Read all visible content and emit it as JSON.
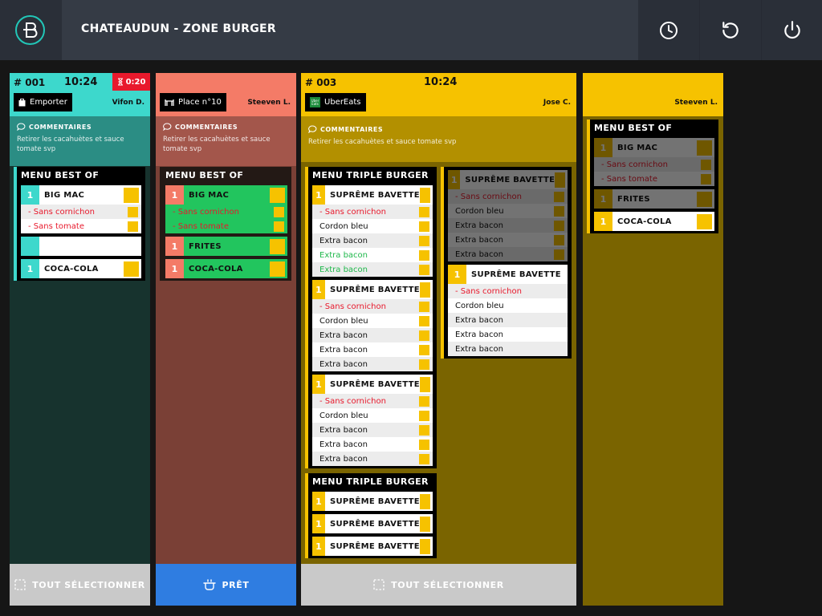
{
  "header": {
    "title": "CHATEAUDUN - ZONE BURGER"
  },
  "orders": [
    {
      "number": "# 001",
      "time": "10:24",
      "timer": "0:20",
      "tag": "Emporter",
      "staff": "Vifon D.",
      "comment_label": "COMMENTAIRES",
      "comment": "Retirer les cacahuètes et sauce tomate svp",
      "menu_title": "MENU BEST OF",
      "items": [
        {
          "qty": "1",
          "name": "BIG MAC",
          "mods": [
            "- Sans cornichon",
            "- Sans tomate"
          ]
        },
        {
          "qty": "",
          "name": "",
          "mods": []
        },
        {
          "qty": "1",
          "name": "COCA-COLA",
          "mods": []
        }
      ],
      "footer": "TOUT SÉLECTIONNER"
    },
    {
      "number": "",
      "time": "",
      "tag": "Place n°10",
      "staff": "Steeven L.",
      "comment_label": "COMMENTAIRES",
      "comment": "Retirer les cacahuètes et sauce tomate svp",
      "menu_title": "MENU BEST OF",
      "items": [
        {
          "qty": "1",
          "name": "BIG MAC",
          "mods": [
            "- Sans cornichon",
            "- Sans tomate"
          ]
        },
        {
          "qty": "1",
          "name": "FRITES",
          "mods": []
        },
        {
          "qty": "1",
          "name": "COCA-COLA",
          "mods": []
        }
      ],
      "footer": "PRÊT"
    },
    {
      "number": "# 003",
      "time": "10:24",
      "tag": "UberEats",
      "tag_logo": "Uber Eats",
      "staff": "Jose C.",
      "comment_label": "COMMENTAIRES",
      "comment": "Retirer les cacahuètes et sauce tomate svp",
      "menu1_title": "MENU TRIPLE BURGER",
      "menu1_items": [
        {
          "qty": "1",
          "name": "SUPRÊME BAVETTE",
          "mods": [
            {
              "t": "- Sans cornichon",
              "k": "mod"
            },
            {
              "t": "Cordon bleu",
              "k": ""
            },
            {
              "t": "Extra bacon",
              "k": ""
            },
            {
              "t": "Extra bacon",
              "k": "grn"
            },
            {
              "t": "Extra bacon",
              "k": "grn"
            }
          ]
        },
        {
          "qty": "1",
          "name": "SUPRÊME BAVETTE",
          "mods": [
            {
              "t": "- Sans cornichon",
              "k": "mod"
            },
            {
              "t": "Cordon bleu",
              "k": ""
            },
            {
              "t": "Extra bacon",
              "k": ""
            },
            {
              "t": "Extra bacon",
              "k": ""
            },
            {
              "t": "Extra bacon",
              "k": ""
            }
          ]
        },
        {
          "qty": "1",
          "name": "SUPRÊME BAVETTE",
          "mods": [
            {
              "t": "- Sans cornichon",
              "k": "mod"
            },
            {
              "t": "Cordon bleu",
              "k": ""
            },
            {
              "t": "Extra bacon",
              "k": ""
            },
            {
              "t": "Extra bacon",
              "k": ""
            },
            {
              "t": "Extra bacon",
              "k": ""
            }
          ]
        }
      ],
      "side_items": [
        {
          "qty": "1",
          "name": "SUPRÊME BAVETTE",
          "dim": true,
          "mods": [
            {
              "t": "- Sans cornichon",
              "k": "mod"
            },
            {
              "t": "Cordon bleu",
              "k": ""
            },
            {
              "t": "Extra bacon",
              "k": ""
            },
            {
              "t": "Extra bacon",
              "k": ""
            },
            {
              "t": "Extra bacon",
              "k": ""
            }
          ]
        },
        {
          "qty": "1",
          "name": "SUPRÊME BAVETTE",
          "dim": false,
          "mods": [
            {
              "t": "- Sans cornichon",
              "k": "mod"
            },
            {
              "t": "Cordon bleu",
              "k": ""
            },
            {
              "t": "Extra bacon",
              "k": ""
            },
            {
              "t": "Extra bacon",
              "k": ""
            },
            {
              "t": "Extra bacon",
              "k": ""
            }
          ]
        }
      ],
      "menu2_title": "MENU TRIPLE BURGER",
      "menu2_items": [
        {
          "qty": "1",
          "name": "SUPRÊME BAVETTE"
        },
        {
          "qty": "1",
          "name": "SUPRÊME BAVETTE"
        },
        {
          "qty": "1",
          "name": "SUPRÊME BAVETTE"
        }
      ],
      "footer": "TOUT SÉLECTIONNER"
    },
    {
      "staff": "Steeven L.",
      "menu_title": "MENU BEST OF",
      "items": [
        {
          "qty": "1",
          "name": "BIG MAC",
          "mods": [
            "- Sans cornichon",
            "- Sans tomate"
          ],
          "dim": true
        },
        {
          "qty": "1",
          "name": "FRITES",
          "mods": [],
          "dim": true
        },
        {
          "qty": "1",
          "name": "COCA-COLA",
          "mods": [],
          "dim": false
        }
      ]
    }
  ],
  "colors": {
    "teal": "#3dd8cc",
    "salmon": "#f47b67",
    "yellow": "#f6c200",
    "dark_yellow": "#7a6400",
    "green": "#22c55e",
    "blue": "#2f7de1",
    "red": "#e8192c"
  },
  "icons": [
    "logo-icon",
    "clock-icon",
    "refresh-icon",
    "power-icon",
    "bag-icon",
    "table-icon",
    "comment-icon",
    "hourglass-icon",
    "select-icon",
    "pot-icon"
  ]
}
